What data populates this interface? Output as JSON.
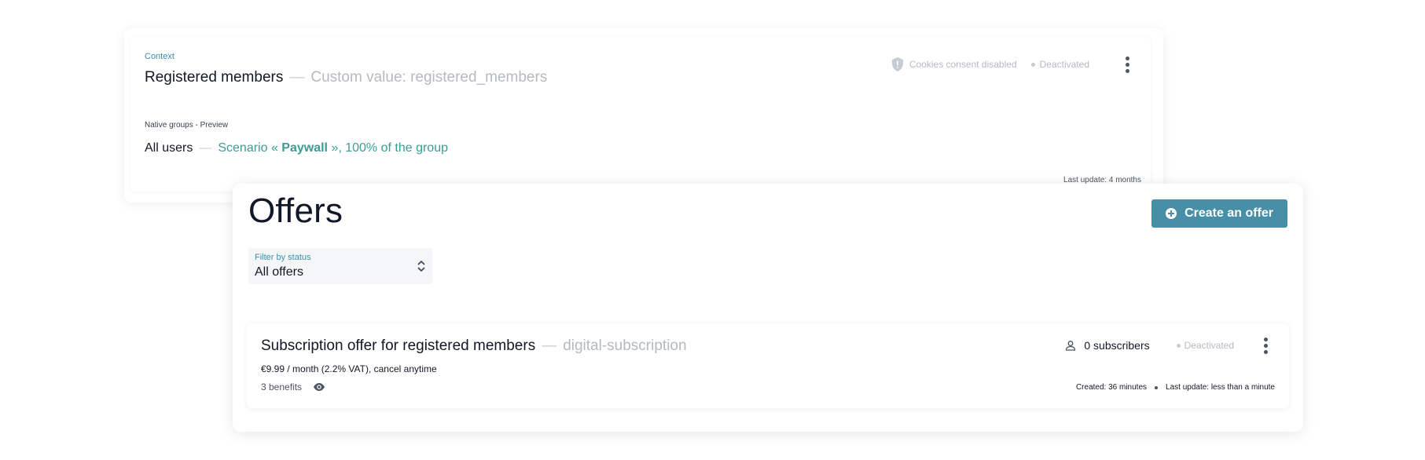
{
  "context": {
    "label": "Context",
    "title": "Registered members",
    "separator": "—",
    "subtitle": "Custom value: registered_members",
    "cookies_status": "Cookies consent disabled",
    "status": "Deactivated",
    "native_groups_label": "Native groups - Preview",
    "group_name": "All users",
    "scenario_prefix": "Scenario « ",
    "scenario_name": "Paywall",
    "scenario_suffix": " », 100% of the group",
    "last_update": "Last update: 4 months"
  },
  "offers": {
    "title": "Offers",
    "create_button": "Create an offer",
    "filter": {
      "label": "Filter by status",
      "value": "All offers"
    },
    "items": [
      {
        "name": "Subscription offer for registered members",
        "separator": "—",
        "code": "digital-subscription",
        "price": "€9.99 / month (2.2% VAT), cancel anytime",
        "benefits": "3 benefits",
        "subscribers": "0 subscribers",
        "status": "Deactivated",
        "created": "Created: 36 minutes",
        "last_update": "Last update: less than a minute"
      }
    ]
  },
  "colors": {
    "accent": "#478fa6",
    "label_blue": "#3a8fb1",
    "scenario_teal": "#3b9b96",
    "muted": "#b4bac2"
  },
  "icons": {
    "shield": "shield-icon",
    "more": "more-vertical-icon",
    "plus": "plus-circle-icon",
    "chevrons": "chevron-up-down-icon",
    "user": "user-icon",
    "eye": "eye-icon"
  }
}
